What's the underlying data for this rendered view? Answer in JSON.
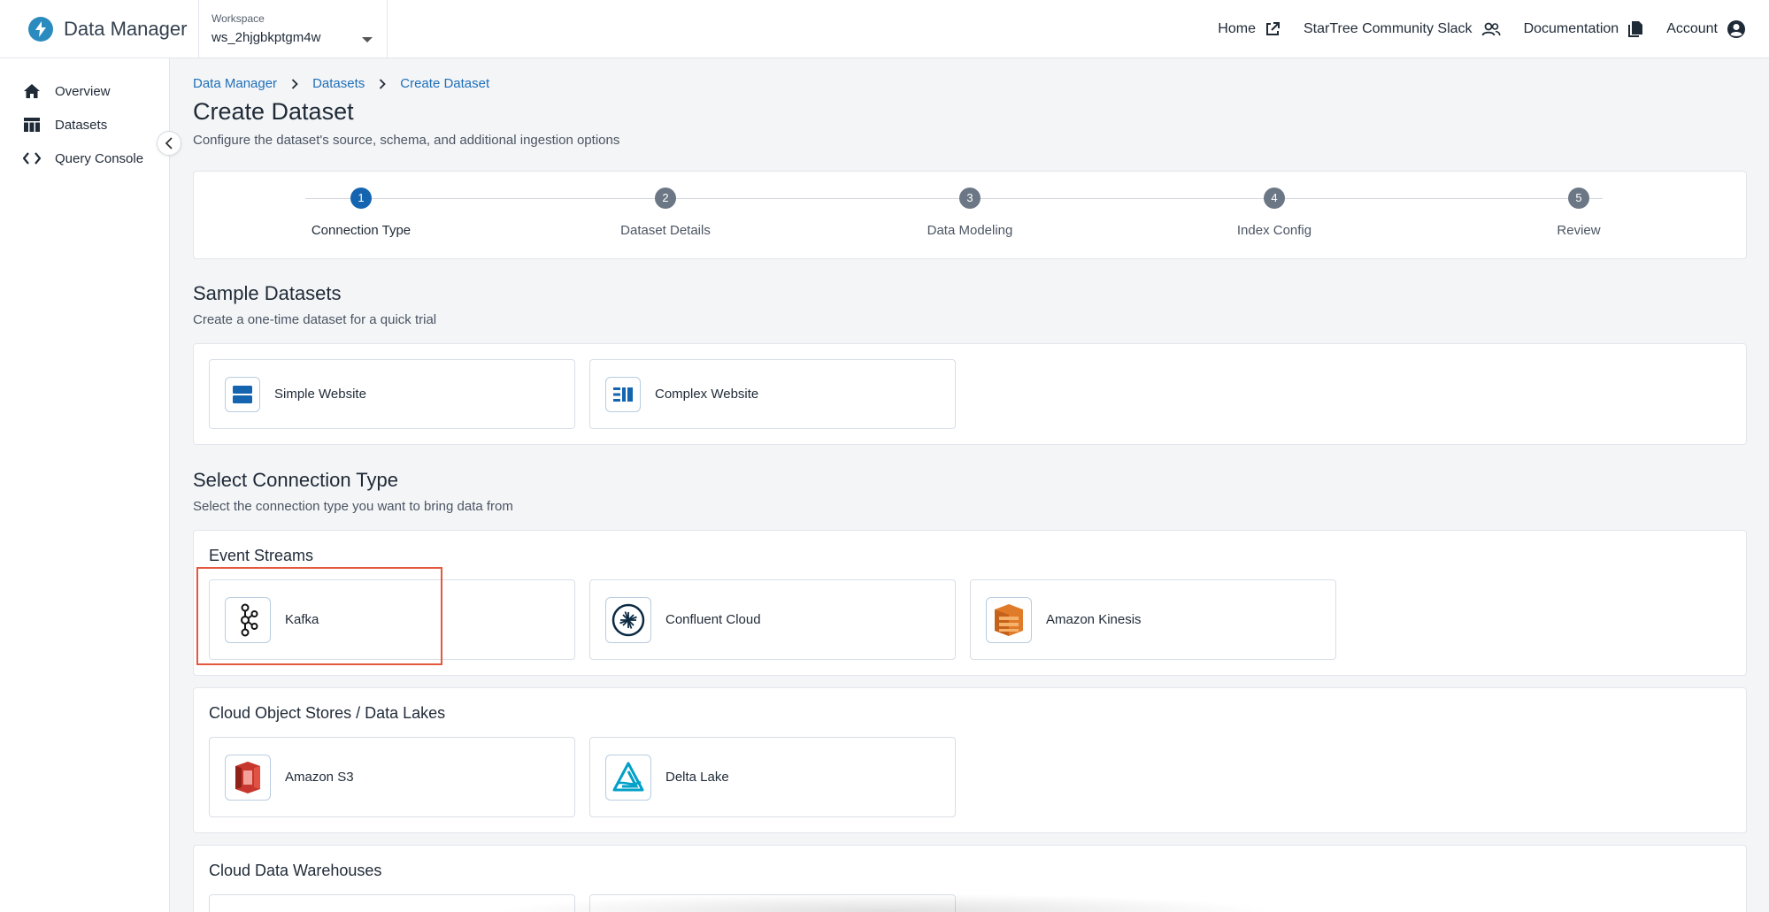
{
  "header": {
    "brand": "Data Manager",
    "workspace_label": "Workspace",
    "workspace_value": "ws_2hjgbkptgm4w",
    "nav": [
      {
        "label": "Home",
        "icon": "external-link-icon"
      },
      {
        "label": "StarTree Community Slack",
        "icon": "people-icon"
      },
      {
        "label": "Documentation",
        "icon": "document-icon"
      },
      {
        "label": "Account",
        "icon": "account-icon"
      }
    ]
  },
  "sidebar": {
    "items": [
      {
        "label": "Overview",
        "icon": "home-icon"
      },
      {
        "label": "Datasets",
        "icon": "table-icon"
      },
      {
        "label": "Query Console",
        "icon": "code-icon"
      }
    ]
  },
  "breadcrumb": [
    "Data Manager",
    "Datasets",
    "Create Dataset"
  ],
  "page": {
    "title": "Create Dataset",
    "subtitle": "Configure the dataset's source, schema, and additional ingestion options"
  },
  "stepper": {
    "active_step": 1,
    "steps": [
      {
        "number": "1",
        "label": "Connection Type"
      },
      {
        "number": "2",
        "label": "Dataset Details"
      },
      {
        "number": "3",
        "label": "Data Modeling"
      },
      {
        "number": "4",
        "label": "Index Config"
      },
      {
        "number": "5",
        "label": "Review"
      }
    ]
  },
  "sample_datasets": {
    "title": "Sample Datasets",
    "subtitle": "Create a one-time dataset for a quick trial",
    "items": [
      {
        "label": "Simple Website",
        "icon": "simple-website-icon"
      },
      {
        "label": "Complex Website",
        "icon": "complex-website-icon"
      }
    ]
  },
  "connection_type": {
    "title": "Select Connection Type",
    "subtitle": "Select the connection type you want to bring data from",
    "groups": [
      {
        "title": "Event Streams",
        "items": [
          {
            "label": "Kafka",
            "icon": "kafka-icon"
          },
          {
            "label": "Confluent Cloud",
            "icon": "confluent-icon"
          },
          {
            "label": "Amazon Kinesis",
            "icon": "kinesis-icon"
          }
        ]
      },
      {
        "title": "Cloud Object Stores / Data Lakes",
        "items": [
          {
            "label": "Amazon S3",
            "icon": "s3-icon"
          },
          {
            "label": "Delta Lake",
            "icon": "delta-lake-icon"
          }
        ]
      },
      {
        "title": "Cloud Data Warehouses",
        "items": []
      }
    ]
  },
  "colors": {
    "accent": "#1464b0",
    "highlight": "#e4583e",
    "step_inactive": "#6b7785"
  }
}
